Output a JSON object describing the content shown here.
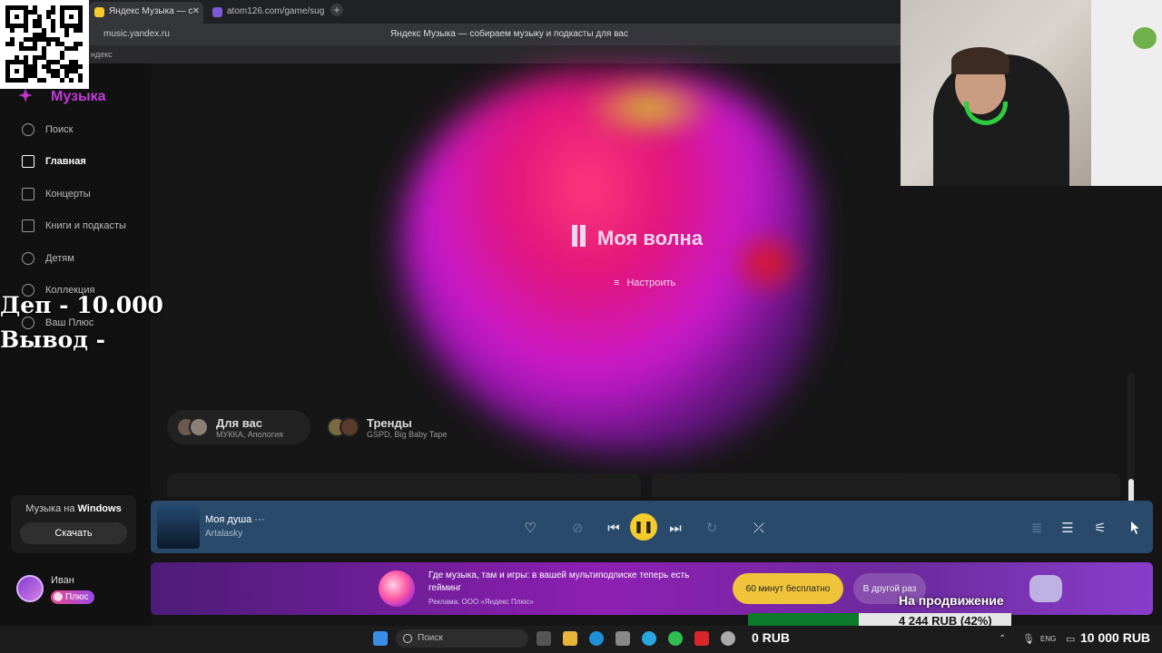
{
  "browser": {
    "tabs": [
      {
        "label": "Яндекс Музыка — с",
        "active": true
      },
      {
        "label": "atom126.com/game/sug",
        "active": false
      }
    ],
    "new_tab_glyph": "+",
    "url": "music.yandex.ru",
    "page_title": "Яндекс Музыка — собираем музыку и подкасты для вас",
    "bookmark": "ндекс"
  },
  "logo": "Музыка",
  "sidebar": {
    "items": [
      {
        "label": "Поиск",
        "icon": "search-icon",
        "active": false
      },
      {
        "label": "Главная",
        "icon": "home-icon",
        "active": true
      },
      {
        "label": "Концерты",
        "icon": "ticket-icon",
        "active": false
      },
      {
        "label": "Книги и подкасты",
        "icon": "book-icon",
        "active": false
      },
      {
        "label": "Детям",
        "icon": "kids-icon",
        "active": false
      },
      {
        "label": "Коллекция",
        "icon": "heart-icon",
        "active": false
      },
      {
        "label": "Ваш Плюс",
        "icon": "plus-icon",
        "active": false
      }
    ],
    "windows_promo": {
      "title": "Музыка на",
      "title_bold": "Windows",
      "button": "Скачать"
    },
    "user": {
      "name": "Иван",
      "badge": "Плюс"
    }
  },
  "wave": {
    "title": "Моя волна",
    "settings": "Настроить"
  },
  "chips": [
    {
      "title": "Для вас",
      "subtitle": "МУККА, Апология"
    },
    {
      "title": "Тренды",
      "subtitle": "GSPD, Big Baby Tape"
    }
  ],
  "player": {
    "track": "Моя душа",
    "artist": "Artalasky",
    "more": "···",
    "state": "playing"
  },
  "banner": {
    "text": "Где музыка, там и игры: в вашей мультиподписке теперь есть гейминг",
    "ad": "Реклама. ООО «Яндекс Плюс»",
    "cta": "60 минут бесплатно",
    "later": "В другой раз"
  },
  "overlay": {
    "dep": "Деп - 10.000",
    "withdraw": "Вывод -",
    "promo_label": "На продвижение",
    "promo_value": "4 244 RUB (42%)",
    "promo_progress": 0.42,
    "balance_left": "0 RUB",
    "balance_right": "10 000 RUB"
  },
  "taskbar": {
    "search": "Поиск",
    "lang": "ENG"
  }
}
